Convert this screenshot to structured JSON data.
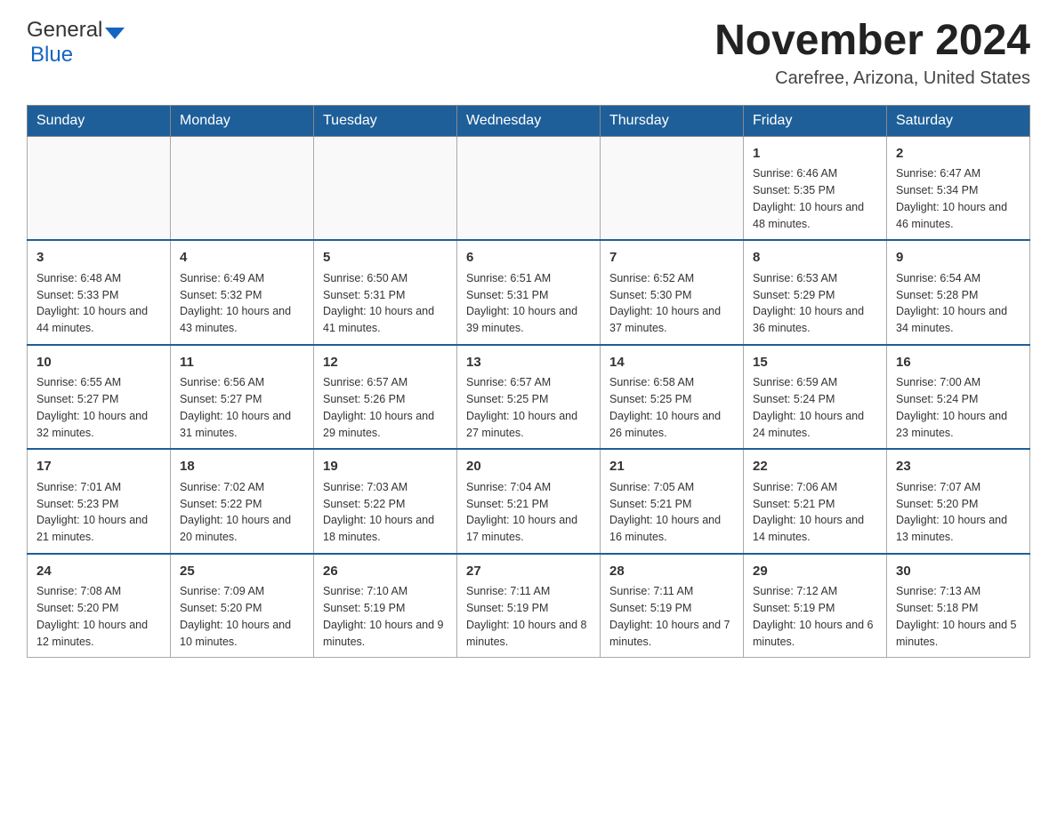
{
  "logo": {
    "general": "General",
    "blue": "Blue"
  },
  "header": {
    "title": "November 2024",
    "subtitle": "Carefree, Arizona, United States"
  },
  "days_of_week": [
    "Sunday",
    "Monday",
    "Tuesday",
    "Wednesday",
    "Thursday",
    "Friday",
    "Saturday"
  ],
  "weeks": [
    {
      "days": [
        {
          "number": "",
          "sunrise": "",
          "sunset": "",
          "daylight": ""
        },
        {
          "number": "",
          "sunrise": "",
          "sunset": "",
          "daylight": ""
        },
        {
          "number": "",
          "sunrise": "",
          "sunset": "",
          "daylight": ""
        },
        {
          "number": "",
          "sunrise": "",
          "sunset": "",
          "daylight": ""
        },
        {
          "number": "",
          "sunrise": "",
          "sunset": "",
          "daylight": ""
        },
        {
          "number": "1",
          "sunrise": "Sunrise: 6:46 AM",
          "sunset": "Sunset: 5:35 PM",
          "daylight": "Daylight: 10 hours and 48 minutes."
        },
        {
          "number": "2",
          "sunrise": "Sunrise: 6:47 AM",
          "sunset": "Sunset: 5:34 PM",
          "daylight": "Daylight: 10 hours and 46 minutes."
        }
      ]
    },
    {
      "days": [
        {
          "number": "3",
          "sunrise": "Sunrise: 6:48 AM",
          "sunset": "Sunset: 5:33 PM",
          "daylight": "Daylight: 10 hours and 44 minutes."
        },
        {
          "number": "4",
          "sunrise": "Sunrise: 6:49 AM",
          "sunset": "Sunset: 5:32 PM",
          "daylight": "Daylight: 10 hours and 43 minutes."
        },
        {
          "number": "5",
          "sunrise": "Sunrise: 6:50 AM",
          "sunset": "Sunset: 5:31 PM",
          "daylight": "Daylight: 10 hours and 41 minutes."
        },
        {
          "number": "6",
          "sunrise": "Sunrise: 6:51 AM",
          "sunset": "Sunset: 5:31 PM",
          "daylight": "Daylight: 10 hours and 39 minutes."
        },
        {
          "number": "7",
          "sunrise": "Sunrise: 6:52 AM",
          "sunset": "Sunset: 5:30 PM",
          "daylight": "Daylight: 10 hours and 37 minutes."
        },
        {
          "number": "8",
          "sunrise": "Sunrise: 6:53 AM",
          "sunset": "Sunset: 5:29 PM",
          "daylight": "Daylight: 10 hours and 36 minutes."
        },
        {
          "number": "9",
          "sunrise": "Sunrise: 6:54 AM",
          "sunset": "Sunset: 5:28 PM",
          "daylight": "Daylight: 10 hours and 34 minutes."
        }
      ]
    },
    {
      "days": [
        {
          "number": "10",
          "sunrise": "Sunrise: 6:55 AM",
          "sunset": "Sunset: 5:27 PM",
          "daylight": "Daylight: 10 hours and 32 minutes."
        },
        {
          "number": "11",
          "sunrise": "Sunrise: 6:56 AM",
          "sunset": "Sunset: 5:27 PM",
          "daylight": "Daylight: 10 hours and 31 minutes."
        },
        {
          "number": "12",
          "sunrise": "Sunrise: 6:57 AM",
          "sunset": "Sunset: 5:26 PM",
          "daylight": "Daylight: 10 hours and 29 minutes."
        },
        {
          "number": "13",
          "sunrise": "Sunrise: 6:57 AM",
          "sunset": "Sunset: 5:25 PM",
          "daylight": "Daylight: 10 hours and 27 minutes."
        },
        {
          "number": "14",
          "sunrise": "Sunrise: 6:58 AM",
          "sunset": "Sunset: 5:25 PM",
          "daylight": "Daylight: 10 hours and 26 minutes."
        },
        {
          "number": "15",
          "sunrise": "Sunrise: 6:59 AM",
          "sunset": "Sunset: 5:24 PM",
          "daylight": "Daylight: 10 hours and 24 minutes."
        },
        {
          "number": "16",
          "sunrise": "Sunrise: 7:00 AM",
          "sunset": "Sunset: 5:24 PM",
          "daylight": "Daylight: 10 hours and 23 minutes."
        }
      ]
    },
    {
      "days": [
        {
          "number": "17",
          "sunrise": "Sunrise: 7:01 AM",
          "sunset": "Sunset: 5:23 PM",
          "daylight": "Daylight: 10 hours and 21 minutes."
        },
        {
          "number": "18",
          "sunrise": "Sunrise: 7:02 AM",
          "sunset": "Sunset: 5:22 PM",
          "daylight": "Daylight: 10 hours and 20 minutes."
        },
        {
          "number": "19",
          "sunrise": "Sunrise: 7:03 AM",
          "sunset": "Sunset: 5:22 PM",
          "daylight": "Daylight: 10 hours and 18 minutes."
        },
        {
          "number": "20",
          "sunrise": "Sunrise: 7:04 AM",
          "sunset": "Sunset: 5:21 PM",
          "daylight": "Daylight: 10 hours and 17 minutes."
        },
        {
          "number": "21",
          "sunrise": "Sunrise: 7:05 AM",
          "sunset": "Sunset: 5:21 PM",
          "daylight": "Daylight: 10 hours and 16 minutes."
        },
        {
          "number": "22",
          "sunrise": "Sunrise: 7:06 AM",
          "sunset": "Sunset: 5:21 PM",
          "daylight": "Daylight: 10 hours and 14 minutes."
        },
        {
          "number": "23",
          "sunrise": "Sunrise: 7:07 AM",
          "sunset": "Sunset: 5:20 PM",
          "daylight": "Daylight: 10 hours and 13 minutes."
        }
      ]
    },
    {
      "days": [
        {
          "number": "24",
          "sunrise": "Sunrise: 7:08 AM",
          "sunset": "Sunset: 5:20 PM",
          "daylight": "Daylight: 10 hours and 12 minutes."
        },
        {
          "number": "25",
          "sunrise": "Sunrise: 7:09 AM",
          "sunset": "Sunset: 5:20 PM",
          "daylight": "Daylight: 10 hours and 10 minutes."
        },
        {
          "number": "26",
          "sunrise": "Sunrise: 7:10 AM",
          "sunset": "Sunset: 5:19 PM",
          "daylight": "Daylight: 10 hours and 9 minutes."
        },
        {
          "number": "27",
          "sunrise": "Sunrise: 7:11 AM",
          "sunset": "Sunset: 5:19 PM",
          "daylight": "Daylight: 10 hours and 8 minutes."
        },
        {
          "number": "28",
          "sunrise": "Sunrise: 7:11 AM",
          "sunset": "Sunset: 5:19 PM",
          "daylight": "Daylight: 10 hours and 7 minutes."
        },
        {
          "number": "29",
          "sunrise": "Sunrise: 7:12 AM",
          "sunset": "Sunset: 5:19 PM",
          "daylight": "Daylight: 10 hours and 6 minutes."
        },
        {
          "number": "30",
          "sunrise": "Sunrise: 7:13 AM",
          "sunset": "Sunset: 5:18 PM",
          "daylight": "Daylight: 10 hours and 5 minutes."
        }
      ]
    }
  ]
}
